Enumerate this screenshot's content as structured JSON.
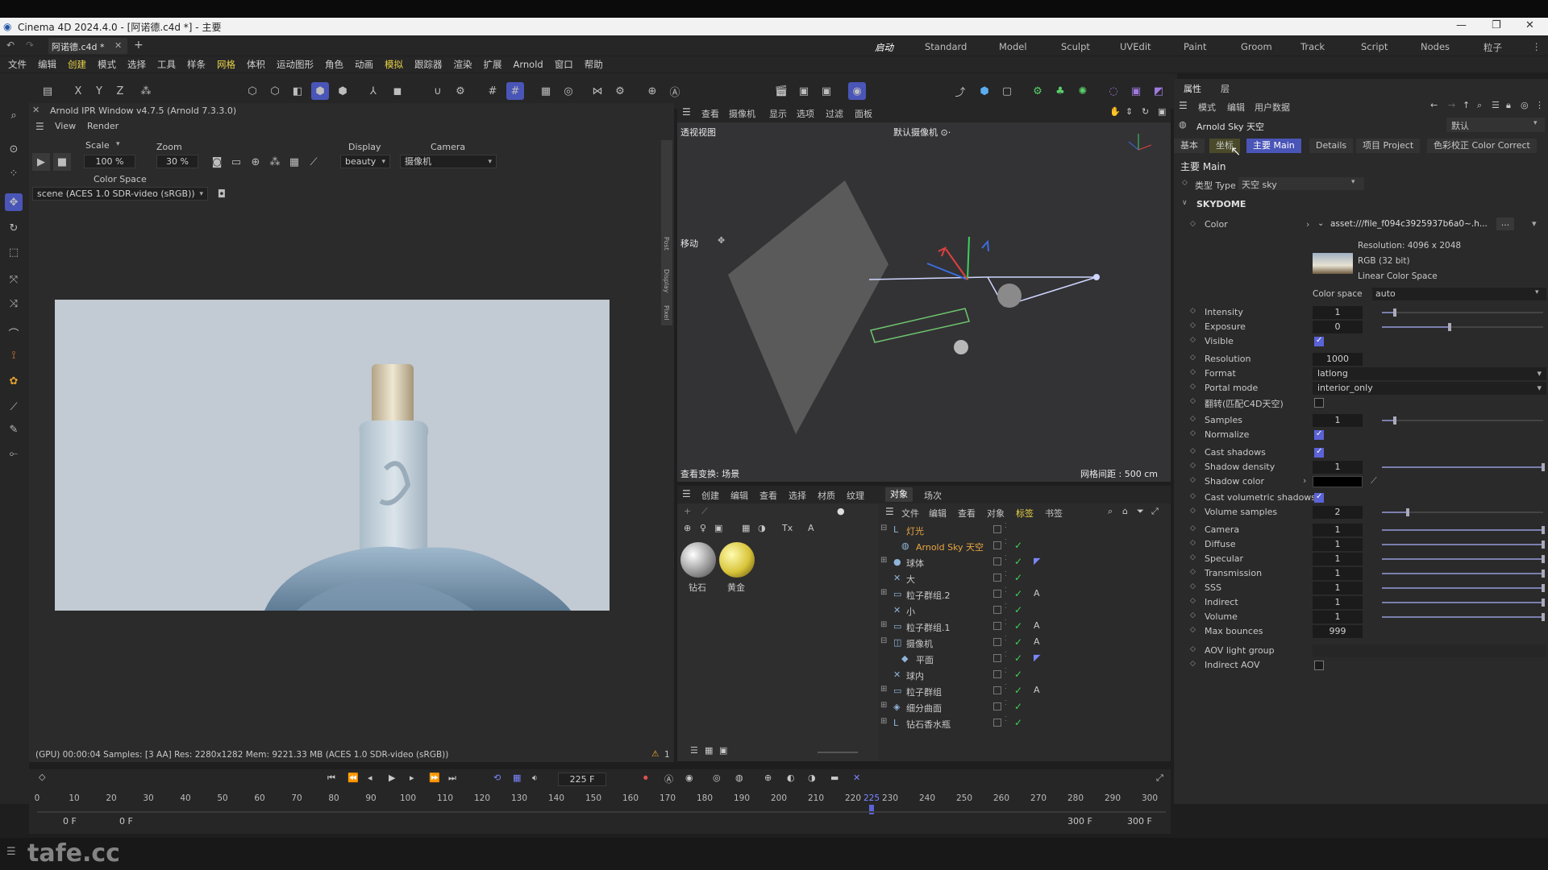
{
  "app": {
    "title": "Cinema 4D 2024.4.0 - [阿诺德.c4d *] - 主要",
    "doc_tab": "阿诺德.c4d *"
  },
  "modes": [
    "启动",
    "Standard",
    "Model",
    "Sculpt",
    "UVEdit",
    "Paint",
    "Groom",
    "Track",
    "Script",
    "Nodes",
    "粒子"
  ],
  "menu": [
    "文件",
    "编辑",
    "创建",
    "模式",
    "选择",
    "工具",
    "样条",
    "网格",
    "体积",
    "运动图形",
    "角色",
    "动画",
    "模拟",
    "跟踪器",
    "渲染",
    "扩展",
    "Arnold",
    "窗口",
    "帮助"
  ],
  "axis": {
    "x": "X",
    "y": "Y",
    "z": "Z"
  },
  "ipr": {
    "title": "Arnold IPR Window v4.7.5 (Arnold 7.3.3.0)",
    "menu_view": "View",
    "menu_render": "Render",
    "scale_label": "Scale",
    "zoom_label": "Zoom",
    "display_label": "Display",
    "camera_label": "Camera",
    "scale_value": "100 %",
    "zoom_value": "30 %",
    "display_value": "beauty",
    "camera_value": "摄像机",
    "colorspace_label": "Color Space",
    "colorspace_value": "scene (ACES 1.0 SDR-video (sRGB))",
    "status": "(GPU) 00:00:04  Samples: [3 AA]  Res: 2280x1282  Mem: 9221.33 MB  (ACES 1.0 SDR-video (sRGB))",
    "warn_count": "1",
    "side_tabs": [
      "Post",
      "Display",
      "Pixel"
    ]
  },
  "viewport": {
    "menu": [
      "查看",
      "摄像机",
      "显示",
      "选项",
      "过滤",
      "面板"
    ],
    "name": "透视视图",
    "camera": "默认摄像机 ⊙·",
    "move_label": "移动",
    "footer_left": "查看变换: 场景",
    "footer_right": "网格间距 : 500 cm"
  },
  "material_panel": {
    "menu": [
      "创建",
      "编辑",
      "查看",
      "选择",
      "材质",
      "纹理"
    ],
    "materials": [
      {
        "name": "钻石",
        "color": "#d8d8d8"
      },
      {
        "name": "黄金",
        "color": "#e8d84a"
      }
    ]
  },
  "object_panel": {
    "tabs": [
      "对象",
      "场次"
    ],
    "menu": [
      "文件",
      "编辑",
      "查看",
      "对象",
      "标签",
      "书签"
    ],
    "rows": [
      {
        "name": "灯光",
        "icon": "L",
        "expand": "⊟",
        "highlight": "#e9a642",
        "tag": ""
      },
      {
        "name": "Arnold Sky 天空",
        "icon": "◍",
        "expand": "",
        "highlight": "#e9a642",
        "tag": "",
        "indent": true
      },
      {
        "name": "球体",
        "icon": "●",
        "expand": "⊞",
        "highlight": "",
        "tag": "◤"
      },
      {
        "name": "大",
        "icon": "✕",
        "expand": "",
        "highlight": "",
        "tag": ""
      },
      {
        "name": "粒子群组.2",
        "icon": "▭",
        "expand": "⊞",
        "highlight": "",
        "tag": "A"
      },
      {
        "name": "小",
        "icon": "✕",
        "expand": "",
        "highlight": "",
        "tag": ""
      },
      {
        "name": "粒子群组.1",
        "icon": "▭",
        "expand": "⊞",
        "highlight": "",
        "tag": "A"
      },
      {
        "name": "摄像机",
        "icon": "◫",
        "expand": "⊟",
        "highlight": "",
        "tag": "A"
      },
      {
        "name": "平面",
        "icon": "◆",
        "expand": "",
        "highlight": "",
        "tag": "◤",
        "indent": true
      },
      {
        "name": "球内",
        "icon": "✕",
        "expand": "",
        "highlight": "",
        "tag": ""
      },
      {
        "name": "粒子群组",
        "icon": "▭",
        "expand": "⊞",
        "highlight": "",
        "tag": "A"
      },
      {
        "name": "细分曲面",
        "icon": "◈",
        "expand": "⊞",
        "highlight": "",
        "tag": ""
      },
      {
        "name": "钻石香水瓶",
        "icon": "L",
        "expand": "⊞",
        "highlight": "",
        "tag": ""
      }
    ]
  },
  "timeline": {
    "current_frame": "225 F",
    "ticks": [
      "0",
      "10",
      "20",
      "30",
      "40",
      "50",
      "60",
      "70",
      "80",
      "90",
      "100",
      "110",
      "120",
      "130",
      "140",
      "150",
      "160",
      "170",
      "180",
      "190",
      "200",
      "210",
      "220",
      "225",
      "230",
      "240",
      "250",
      "260",
      "270",
      "280",
      "290",
      "300"
    ],
    "start": "0 F",
    "start2": "0 F",
    "end": "300 F",
    "end2": "300 F",
    "playhead_frame": 225,
    "max_frame": 300
  },
  "attributes": {
    "tabs_top": [
      "属性",
      "层"
    ],
    "menu": [
      "模式",
      "编辑",
      "用户数据"
    ],
    "object_name": "Arnold Sky 天空",
    "preset": "默认",
    "tabs": [
      "基本",
      "坐标",
      "主要 Main",
      "Details",
      "项目 Project",
      "色彩校正 Color Correct"
    ],
    "section_main": "主要 Main",
    "type_label": "类型 Type",
    "type_value": "天空 sky",
    "section_skydome": "SKYDOME",
    "color_label": "Color",
    "color_asset": "asset:///file_f094c3925937b6a0~.h...",
    "color_btn": "...",
    "tex_info": [
      "Resolution: 4096 x 2048",
      "RGB (32 bit)",
      "Linear Color Space"
    ],
    "colorspace_label": "Color space",
    "colorspace_value": "auto",
    "rows": [
      {
        "label": "Intensity",
        "kind": "slider",
        "value": "1",
        "frac": 0.08
      },
      {
        "label": "Exposure",
        "kind": "slider",
        "value": "0",
        "frac": 0.42
      },
      {
        "label": "Visible",
        "kind": "check",
        "on": true
      },
      {
        "label": "Resolution",
        "kind": "value",
        "value": "1000"
      },
      {
        "label": "Format",
        "kind": "dd",
        "value": "latlong"
      },
      {
        "label": "Portal mode",
        "kind": "dd",
        "value": "interior_only"
      },
      {
        "label": "翻转(匹配C4D天空)",
        "kind": "check",
        "on": false
      },
      {
        "label": "Samples",
        "kind": "slider",
        "value": "1",
        "frac": 0.08
      },
      {
        "label": "Normalize",
        "kind": "check",
        "on": true
      },
      {
        "label": "Cast shadows",
        "kind": "check",
        "on": true
      },
      {
        "label": "Shadow density",
        "kind": "slider",
        "value": "1",
        "frac": 1.0
      },
      {
        "label": "Shadow color",
        "kind": "color",
        "value": "#000000"
      },
      {
        "label": "Cast volumetric shadows",
        "kind": "check",
        "on": true
      },
      {
        "label": "Volume samples",
        "kind": "slider",
        "value": "2",
        "frac": 0.16
      },
      {
        "label": "Camera",
        "kind": "slider",
        "value": "1",
        "frac": 1.0
      },
      {
        "label": "Diffuse",
        "kind": "slider",
        "value": "1",
        "frac": 1.0
      },
      {
        "label": "Specular",
        "kind": "slider",
        "value": "1",
        "frac": 1.0
      },
      {
        "label": "Transmission",
        "kind": "slider",
        "value": "1",
        "frac": 1.0
      },
      {
        "label": "SSS",
        "kind": "slider",
        "value": "1",
        "frac": 1.0
      },
      {
        "label": "Indirect",
        "kind": "slider",
        "value": "1",
        "frac": 1.0
      },
      {
        "label": "Volume",
        "kind": "slider",
        "value": "1",
        "frac": 1.0
      },
      {
        "label": "Max bounces",
        "kind": "value",
        "value": "999"
      },
      {
        "label": "AOV light group",
        "kind": "wide",
        "value": ""
      },
      {
        "label": "Indirect AOV",
        "kind": "check",
        "on": false
      }
    ]
  },
  "watermark": "tafe.cc",
  "colors": {
    "accent": "#5b63d6",
    "check": "#3fd15a",
    "highlight": "#e9a642"
  }
}
